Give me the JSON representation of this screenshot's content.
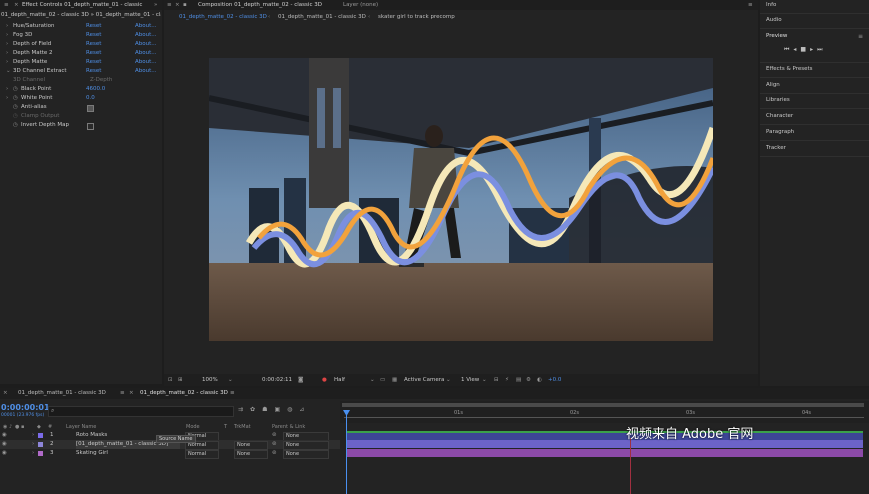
{
  "effect_controls": {
    "tab_title": "Effect Controls 01_depth_matte_01 - classic",
    "source_path": "01_depth_matte_02 - classic 3D » 01_depth_matte_01 - classic",
    "effects": [
      {
        "label": "Hue/Saturation",
        "reset": "Reset",
        "about": "About..."
      },
      {
        "label": "Fog 3D",
        "reset": "Reset",
        "about": "About..."
      },
      {
        "label": "Depth of Field",
        "reset": "Reset",
        "about": "About..."
      },
      {
        "label": "Depth Matte 2",
        "reset": "Reset",
        "about": "About..."
      },
      {
        "label": "Depth Matte",
        "reset": "Reset",
        "about": "About..."
      },
      {
        "label": "3D Channel Extract",
        "reset": "Reset",
        "about": "About..."
      }
    ],
    "properties": {
      "channel_label": "3D Channel",
      "channel_value": "Z-Depth",
      "black_point_label": "Black Point",
      "black_point_value": "4600.0",
      "white_point_label": "White Point",
      "white_point_value": "0.0",
      "antialias_label": "Anti-alias",
      "clamp_label": "Clamp Output",
      "invert_label": "Invert Depth Map"
    }
  },
  "composition": {
    "tab_title": "Composition 01_depth_matte_02 - classic 3D",
    "layer_tab": "Layer (none)",
    "breadcrumbs": [
      "01_depth_matte_02 - classic 3D",
      "01_depth_matte_01 - classic 3D",
      "skater girl to track precomp"
    ],
    "footer": {
      "zoom": "100%",
      "timecode": "0:00:02:11",
      "resolution": "Half",
      "camera": "Active Camera",
      "view": "1 View",
      "exposure": "+0.0"
    }
  },
  "right_panels": {
    "top_items": [
      "Info",
      "Audio"
    ],
    "preview_label": "Preview",
    "items": [
      "Effects & Presets",
      "Align",
      "Libraries",
      "Character",
      "Paragraph",
      "Tracker"
    ]
  },
  "timeline": {
    "tabs": [
      "01_depth_matte_01 - classic 3D",
      "01_depth_matte_02 - classic 3D"
    ],
    "timecode": "0:00:00:01",
    "frame_info": "00001 (23.976 fps)",
    "search_placeholder": "",
    "columns": {
      "layer_name": "Layer Name",
      "mode": "Mode",
      "t": "T",
      "trkmat": "TrkMat",
      "parent": "Parent & Link"
    },
    "tooltip": "Source Name",
    "ruler_marks": [
      "",
      "01s",
      "02s",
      "03s",
      "04s"
    ],
    "layers": [
      {
        "index": "1",
        "name": "Roto Masks",
        "mode": "Normal",
        "trkmat": "",
        "parent": "None",
        "color": "#7b6be8"
      },
      {
        "index": "2",
        "name": "[01_depth_matte_01 - classic 3D]",
        "mode": "Normal",
        "trkmat": "None",
        "parent": "None",
        "color": "#8e86d9"
      },
      {
        "index": "3",
        "name": "Skating Girl",
        "mode": "Normal",
        "trkmat": "None",
        "parent": "None",
        "color": "#b06ac8"
      }
    ]
  },
  "watermark": "视频来自 Adobe 官网",
  "colors": {
    "accent_blue": "#4f8fe6",
    "playhead": "#4a90f0",
    "track_purple": "#6c63c8",
    "track_violet": "#8c4aa8",
    "track_green": "#3aa14a"
  }
}
